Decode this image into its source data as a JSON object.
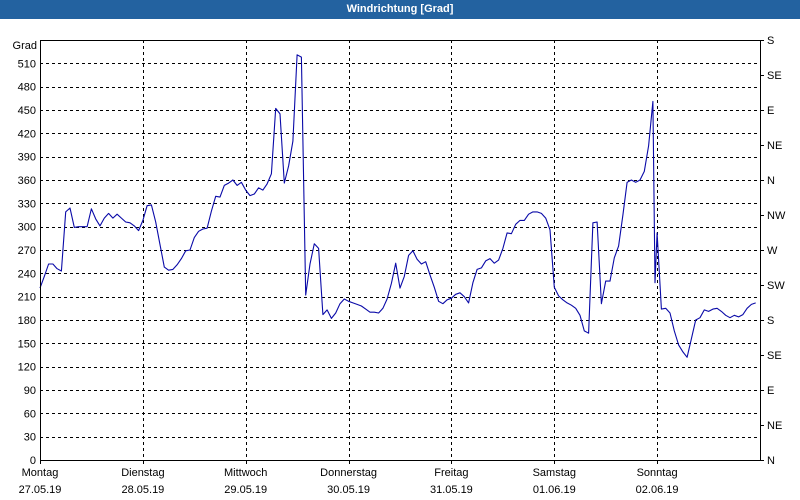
{
  "colors": {
    "title_bar": "#2362a0",
    "title_text": "#ffffff",
    "series_line": "#0a0aa8",
    "grid": "#000000",
    "background": "#ffffff"
  },
  "chart_data": {
    "type": "line",
    "title": "Windrichtung [Grad]",
    "ylabel": "Grad",
    "ylim": [
      0,
      540
    ],
    "xlim": [
      "27.05.19 00:00",
      "03.06.19 00:00"
    ],
    "grid": true,
    "y_ticks": [
      0,
      30,
      60,
      90,
      120,
      150,
      180,
      210,
      240,
      270,
      300,
      330,
      360,
      390,
      420,
      450,
      480,
      510
    ],
    "y2_ticks": [
      {
        "value": 0,
        "label": "N"
      },
      {
        "value": 45,
        "label": "NE"
      },
      {
        "value": 90,
        "label": "E"
      },
      {
        "value": 135,
        "label": "SE"
      },
      {
        "value": 180,
        "label": "S"
      },
      {
        "value": 225,
        "label": "SW"
      },
      {
        "value": 270,
        "label": "W"
      },
      {
        "value": 315,
        "label": "NW"
      },
      {
        "value": 360,
        "label": "N"
      },
      {
        "value": 405,
        "label": "NE"
      },
      {
        "value": 450,
        "label": "E"
      },
      {
        "value": 495,
        "label": "SE"
      },
      {
        "value": 540,
        "label": "S"
      }
    ],
    "x_ticks": [
      {
        "at": "27.05.19 00:00",
        "day": "Montag",
        "date": "27.05.19"
      },
      {
        "at": "28.05.19 00:00",
        "day": "Dienstag",
        "date": "28.05.19"
      },
      {
        "at": "29.05.19 00:00",
        "day": "Mittwoch",
        "date": "29.05.19"
      },
      {
        "at": "30.05.19 00:00",
        "day": "Donnerstag",
        "date": "30.05.19"
      },
      {
        "at": "31.05.19 00:00",
        "day": "Freitag",
        "date": "31.05.19"
      },
      {
        "at": "01.06.19 00:00",
        "day": "Samstag",
        "date": "01.06.19"
      },
      {
        "at": "02.06.19 00:00",
        "day": "Sonntag",
        "date": "02.06.19"
      }
    ],
    "x": [
      "27.05.19 00:00",
      "27.05.19 01:00",
      "27.05.19 02:00",
      "27.05.19 03:00",
      "27.05.19 04:00",
      "27.05.19 05:00",
      "27.05.19 06:00",
      "27.05.19 07:00",
      "27.05.19 08:00",
      "27.05.19 09:00",
      "27.05.19 10:00",
      "27.05.19 11:00",
      "27.05.19 12:00",
      "27.05.19 13:00",
      "27.05.19 14:00",
      "27.05.19 15:00",
      "27.05.19 16:00",
      "27.05.19 17:00",
      "27.05.19 18:00",
      "27.05.19 19:00",
      "27.05.19 20:00",
      "27.05.19 21:00",
      "27.05.19 22:00",
      "27.05.19 23:00",
      "28.05.19 00:00",
      "28.05.19 01:00",
      "28.05.19 02:00",
      "28.05.19 03:00",
      "28.05.19 04:00",
      "28.05.19 05:00",
      "28.05.19 06:00",
      "28.05.19 07:00",
      "28.05.19 08:00",
      "28.05.19 09:00",
      "28.05.19 10:00",
      "28.05.19 11:00",
      "28.05.19 12:00",
      "28.05.19 13:00",
      "28.05.19 14:00",
      "28.05.19 15:00",
      "28.05.19 16:00",
      "28.05.19 17:00",
      "28.05.19 18:00",
      "28.05.19 19:00",
      "28.05.19 20:00",
      "28.05.19 21:00",
      "28.05.19 22:00",
      "28.05.19 23:00",
      "29.05.19 00:00",
      "29.05.19 01:00",
      "29.05.19 02:00",
      "29.05.19 03:00",
      "29.05.19 04:00",
      "29.05.19 05:00",
      "29.05.19 06:00",
      "29.05.19 07:00",
      "29.05.19 08:00",
      "29.05.19 09:00",
      "29.05.19 10:00",
      "29.05.19 11:00",
      "29.05.19 12:00",
      "29.05.19 13:00",
      "29.05.19 14:00",
      "29.05.19 15:00",
      "29.05.19 16:00",
      "29.05.19 17:00",
      "29.05.19 18:00",
      "29.05.19 19:00",
      "29.05.19 20:00",
      "29.05.19 21:00",
      "29.05.19 22:00",
      "29.05.19 23:00",
      "30.05.19 00:00",
      "30.05.19 01:00",
      "30.05.19 02:00",
      "30.05.19 03:00",
      "30.05.19 04:00",
      "30.05.19 05:00",
      "30.05.19 06:00",
      "30.05.19 07:00",
      "30.05.19 08:00",
      "30.05.19 09:00",
      "30.05.19 10:00",
      "30.05.19 11:00",
      "30.05.19 12:00",
      "30.05.19 13:00",
      "30.05.19 14:00",
      "30.05.19 15:00",
      "30.05.19 16:00",
      "30.05.19 17:00",
      "30.05.19 18:00",
      "30.05.19 19:00",
      "30.05.19 20:00",
      "30.05.19 21:00",
      "30.05.19 22:00",
      "30.05.19 23:00",
      "31.05.19 00:00",
      "31.05.19 01:00",
      "31.05.19 02:00",
      "31.05.19 03:00",
      "31.05.19 04:00",
      "31.05.19 05:00",
      "31.05.19 06:00",
      "31.05.19 07:00",
      "31.05.19 08:00",
      "31.05.19 09:00",
      "31.05.19 10:00",
      "31.05.19 11:00",
      "31.05.19 12:00",
      "31.05.19 13:00",
      "31.05.19 14:00",
      "31.05.19 15:00",
      "31.05.19 16:00",
      "31.05.19 17:00",
      "31.05.19 18:00",
      "31.05.19 19:00",
      "31.05.19 20:00",
      "31.05.19 21:00",
      "31.05.19 22:00",
      "31.05.19 23:00",
      "01.06.19 00:00",
      "01.06.19 01:00",
      "01.06.19 02:00",
      "01.06.19 03:00",
      "01.06.19 04:00",
      "01.06.19 05:00",
      "01.06.19 06:00",
      "01.06.19 07:00",
      "01.06.19 08:00",
      "01.06.19 09:00",
      "01.06.19 10:00",
      "01.06.19 11:00",
      "01.06.19 12:00",
      "01.06.19 13:00",
      "01.06.19 14:00",
      "01.06.19 15:00",
      "01.06.19 16:00",
      "01.06.19 17:00",
      "01.06.19 18:00",
      "01.06.19 19:00",
      "01.06.19 20:00",
      "01.06.19 21:00",
      "01.06.19 22:00",
      "01.06.19 23:00",
      "01.06.19 23:30",
      "02.06.19 00:00",
      "02.06.19 01:00",
      "02.06.19 02:00",
      "02.06.19 03:00",
      "02.06.19 04:00",
      "02.06.19 05:00",
      "02.06.19 06:00",
      "02.06.19 07:00",
      "02.06.19 08:00",
      "02.06.19 09:00",
      "02.06.19 10:00",
      "02.06.19 11:00",
      "02.06.19 12:00",
      "02.06.19 13:00",
      "02.06.19 14:00",
      "02.06.19 15:00",
      "02.06.19 16:00",
      "02.06.19 17:00",
      "02.06.19 18:00",
      "02.06.19 19:00",
      "02.06.19 20:00",
      "02.06.19 21:00",
      "02.06.19 22:00",
      "02.06.19 23:00"
    ],
    "y": [
      221,
      236,
      252,
      252,
      246,
      243,
      319,
      324,
      299,
      300,
      300,
      300,
      323,
      310,
      301,
      311,
      317,
      311,
      316,
      311,
      306,
      305,
      301,
      295,
      308,
      327,
      328,
      306,
      277,
      248,
      244,
      245,
      251,
      259,
      269,
      270,
      286,
      294,
      297,
      298,
      320,
      339,
      338,
      353,
      356,
      360,
      353,
      357,
      347,
      340,
      342,
      350,
      347,
      355,
      368,
      452,
      445,
      356,
      378,
      410,
      521,
      518,
      212,
      252,
      278,
      272,
      187,
      193,
      182,
      189,
      201,
      207,
      204,
      202,
      200,
      198,
      194,
      190,
      190,
      189,
      195,
      207,
      227,
      253,
      221,
      236,
      263,
      269,
      258,
      252,
      255,
      238,
      222,
      204,
      201,
      206,
      208,
      213,
      215,
      210,
      202,
      228,
      245,
      247,
      256,
      259,
      253,
      257,
      272,
      292,
      291,
      303,
      308,
      308,
      316,
      319,
      319,
      317,
      311,
      296,
      222,
      211,
      206,
      202,
      199,
      195,
      186,
      166,
      163,
      305,
      306,
      201,
      230,
      230,
      260,
      275,
      315,
      357,
      360,
      357,
      360,
      371,
      404,
      461,
      228,
      292,
      194,
      195,
      189,
      166,
      148,
      139,
      132,
      156,
      180,
      183,
      193,
      191,
      194,
      195,
      191,
      186,
      183,
      186,
      184,
      187,
      195,
      200,
      202
    ]
  }
}
